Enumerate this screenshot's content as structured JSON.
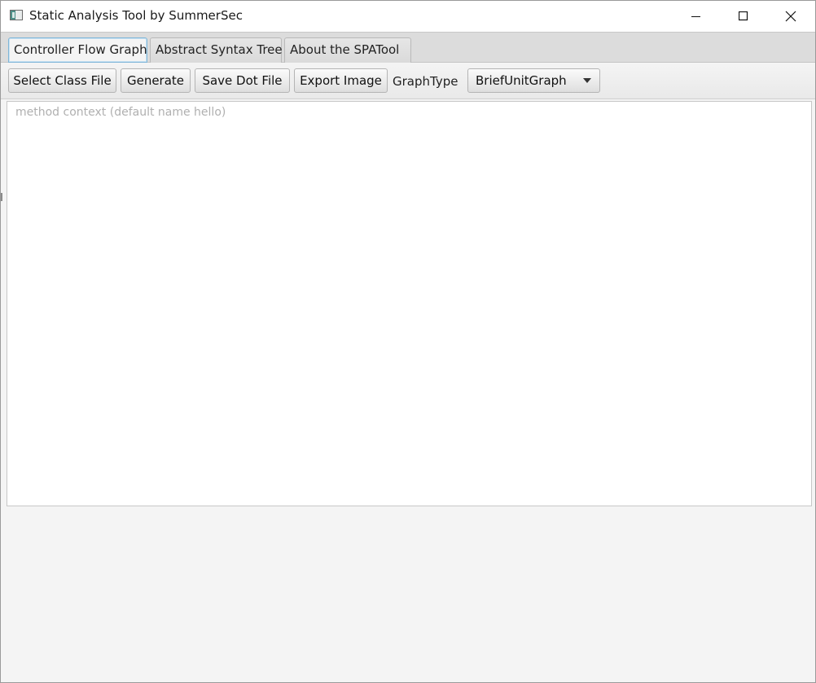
{
  "window": {
    "title": "Static Analysis Tool by SummerSec",
    "icon": "app-window-icon"
  },
  "tabs": [
    {
      "label": "Controller Flow Graph",
      "selected": true
    },
    {
      "label": "Abstract Syntax Tree",
      "selected": false
    },
    {
      "label": "About the SPATool",
      "selected": false
    }
  ],
  "toolbar": {
    "select_class_label": "Select Class File",
    "generate_label": "Generate",
    "save_dot_label": "Save Dot File",
    "export_image_label": "Export Image",
    "graph_type_label": "GraphType",
    "graph_type_value": "BriefUnitGraph"
  },
  "editor": {
    "value": "",
    "placeholder": "method context (default name hello)"
  },
  "colors": {
    "selected_tab_border": "#7fb6d8",
    "placeholder_text": "#b0b0b0"
  }
}
